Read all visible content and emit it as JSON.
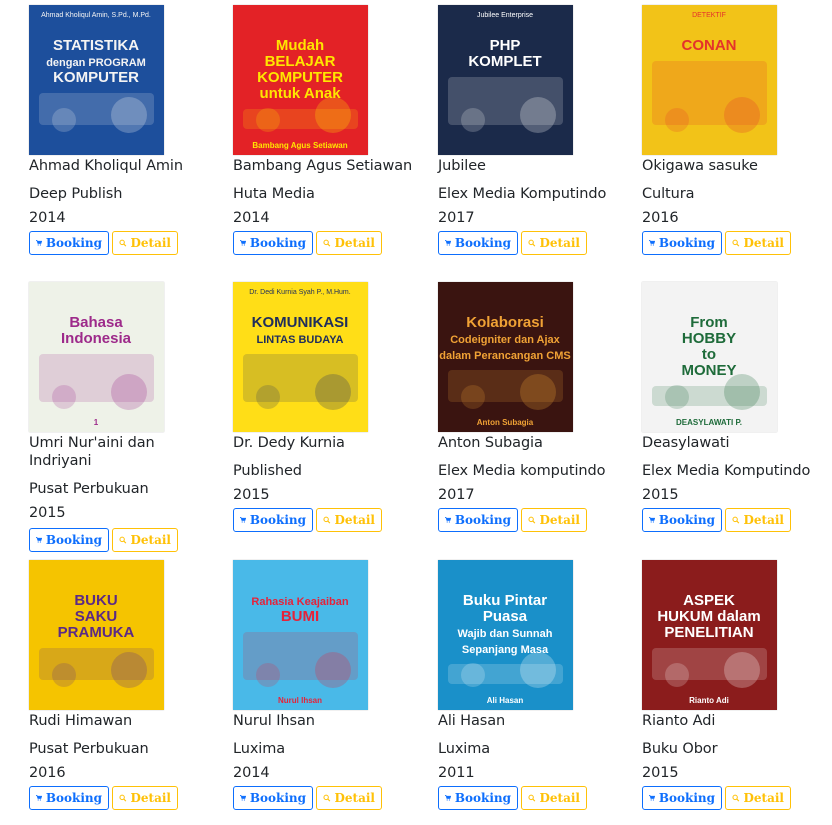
{
  "books": [
    {
      "author": "Ahmad Kholiqul Amin",
      "publisher": "Deep Publish",
      "year": "2014",
      "cover": {
        "bg": "#1d4f9c",
        "accent": "#f4f4f4",
        "title_lines": [
          "STATISTIKA",
          "dengan PROGRAM",
          "KOMPUTER"
        ],
        "top_text": "Ahmad Kholiqul Amin, S.Pd., M.Pd.",
        "bottom_text": ""
      }
    },
    {
      "author": "Bambang Agus Setiawan",
      "publisher": "Huta Media",
      "year": "2014",
      "cover": {
        "bg": "#e32226",
        "accent": "#ffe600",
        "title_lines": [
          "Mudah",
          "BELAJAR",
          "KOMPUTER",
          "untuk Anak"
        ],
        "top_text": "",
        "bottom_text": "Bambang Agus Setiawan"
      }
    },
    {
      "author": "Jubilee",
      "publisher": "Elex Media Komputindo",
      "year": "2017",
      "cover": {
        "bg": "#1b2a4a",
        "accent": "#ffffff",
        "title_lines": [
          "PHP",
          "KOMPLET"
        ],
        "top_text": "Jubilee Enterprise",
        "bottom_text": ""
      }
    },
    {
      "author": "Okigawa sasuke",
      "publisher": "Cultura",
      "year": "2016",
      "cover": {
        "bg": "#f2c318",
        "accent": "#e4322b",
        "title_lines": [
          "CONAN"
        ],
        "top_text": "DETEKTIF",
        "bottom_text": ""
      }
    },
    {
      "author": "Umri Nur'aini dan Indriyani",
      "publisher": "Pusat Perbukuan",
      "year": "2015",
      "cover": {
        "bg": "#eef2e8",
        "accent": "#9d2a8a",
        "title_lines": [
          "Bahasa",
          "Indonesia"
        ],
        "top_text": "",
        "bottom_text": "1"
      }
    },
    {
      "author": "Dr. Dedy Kurnia",
      "publisher": "Published",
      "year": "2015",
      "cover": {
        "bg": "#ffde17",
        "accent": "#1f2d5c",
        "title_lines": [
          "KOMUNIKASI",
          "LINTAS BUDAYA"
        ],
        "top_text": "Dr. Dedi Kurnia Syah P., M.Hum.",
        "bottom_text": ""
      }
    },
    {
      "author": "Anton Subagia",
      "publisher": "Elex Media komputindo",
      "year": "2017",
      "cover": {
        "bg": "#3a1410",
        "accent": "#f0a235",
        "title_lines": [
          "Kolaborasi",
          "Codeigniter dan Ajax",
          "dalam Perancangan CMS"
        ],
        "top_text": "",
        "bottom_text": "Anton Subagia"
      }
    },
    {
      "author": "Deasylawati",
      "publisher": "Elex Media Komputindo",
      "year": "2015",
      "cover": {
        "bg": "#f3f3f3",
        "accent": "#1e6b3a",
        "title_lines": [
          "From",
          "HOBBY",
          "to",
          "MONEY"
        ],
        "top_text": "",
        "bottom_text": "DEASYLAWATI P."
      }
    },
    {
      "author": "Rudi Himawan",
      "publisher": "Pusat Perbukuan",
      "year": "2016",
      "cover": {
        "bg": "#f5c400",
        "accent": "#5b2a86",
        "title_lines": [
          "BUKU",
          "SAKU",
          "PRAMUKA"
        ],
        "top_text": "",
        "bottom_text": ""
      }
    },
    {
      "author": "Nurul Ihsan",
      "publisher": "Luxima",
      "year": "2014",
      "cover": {
        "bg": "#49b9e8",
        "accent": "#e5233a",
        "title_lines": [
          "Rahasia Keajaiban",
          "BUMI"
        ],
        "top_text": "",
        "bottom_text": "Nurul Ihsan"
      }
    },
    {
      "author": "Ali Hasan",
      "publisher": "Luxima",
      "year": "2011",
      "cover": {
        "bg": "#1a90c9",
        "accent": "#ffffff",
        "title_lines": [
          "Buku Pintar",
          "Puasa",
          "Wajib dan Sunnah",
          "Sepanjang Masa"
        ],
        "top_text": "",
        "bottom_text": "Ali Hasan"
      }
    },
    {
      "author": "Rianto Adi",
      "publisher": "Buku Obor",
      "year": "2015",
      "cover": {
        "bg": "#8b1c1c",
        "accent": "#ffffff",
        "title_lines": [
          "ASPEK",
          "HUKUM dalam",
          "PENELITIAN"
        ],
        "top_text": "",
        "bottom_text": "Rianto Adi"
      }
    }
  ],
  "buttons": {
    "booking_label": "Booking",
    "detail_label": "Detail",
    "booking_icon": "shopping-cart-icon",
    "detail_icon": "search-icon",
    "booking_color": "#0d6efd",
    "detail_color": "#ffc107"
  }
}
